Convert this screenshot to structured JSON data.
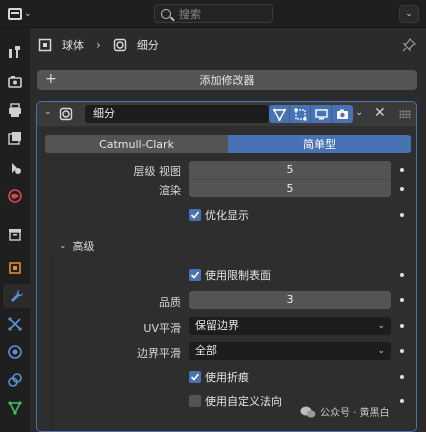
{
  "header": {
    "search_placeholder": "搜索",
    "editor_type_icon": "properties-editor-icon",
    "menu_icon": "chevron-down-icon"
  },
  "sidebar_tabs": [
    {
      "name": "tool-icon"
    },
    {
      "name": "render-icon"
    },
    {
      "name": "output-icon"
    },
    {
      "name": "view-layer-icon"
    },
    {
      "name": "scene-icon"
    },
    {
      "name": "world-icon"
    },
    {
      "name": "collection-icon"
    },
    {
      "name": "object-icon"
    },
    {
      "name": "modifier-wrench-icon",
      "active": true
    },
    {
      "name": "particles-icon"
    },
    {
      "name": "physics-icon"
    },
    {
      "name": "constraints-icon"
    },
    {
      "name": "data-icon"
    }
  ],
  "breadcrumb": {
    "object": "球体",
    "modifier": "细分"
  },
  "add_modifier_label": "添加修改器",
  "modifier": {
    "name": "细分",
    "tabs": [
      "Catmull-Clark",
      "简单型"
    ],
    "active_tab": "简单型",
    "levels_viewport_label": "层级 视图",
    "levels_viewport": "5",
    "render_label": "渲染",
    "render": "5",
    "optimal_display_label": "优化显示",
    "optimal_display": true,
    "advanced_label": "高级",
    "use_limit_surface_label": "使用限制表面",
    "use_limit_surface": true,
    "quality_label": "品质",
    "quality": "3",
    "uv_smooth_label": "UV平滑",
    "uv_smooth": "保留边界",
    "boundary_smooth_label": "边界平滑",
    "boundary_smooth": "全部",
    "use_creases_label": "使用折痕",
    "use_creases": true,
    "use_custom_normals_label": "使用自定义法向",
    "use_custom_normals": false
  },
  "watermark": "公众号 · 黄黑白",
  "colors": {
    "accent": "#4772b3",
    "panel_bg": "#2e2e2e",
    "field_bg": "#545454"
  }
}
